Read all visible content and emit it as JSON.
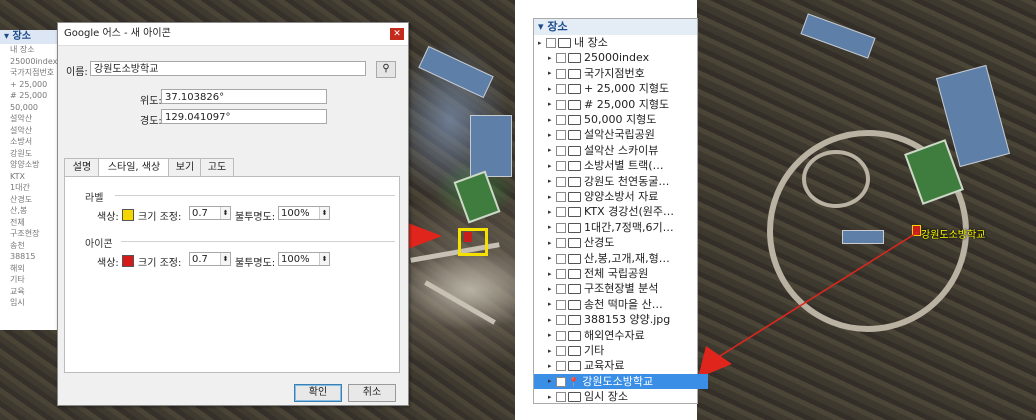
{
  "left_panel": {
    "header": "▾ 장소",
    "rows": [
      "내 장소",
      "25000index",
      "국가지점번호",
      "+ 25,000",
      "# 25,000",
      "50,000",
      "설악산",
      "설악산",
      "소방서",
      "강원도",
      "양양소방",
      "KTX",
      "1대간",
      "산경도",
      "산,봉",
      "전체",
      "구조현장",
      "송천",
      "38815",
      "해외",
      "기타",
      "교육",
      "임시"
    ]
  },
  "dialog": {
    "title": "Google 어스 - 새 아이콘",
    "name_label": "이름:",
    "name_value": "강원도소방학교",
    "lat_label": "위도:",
    "lat_value": "37.103826°",
    "lng_label": "경도:",
    "lng_value": "129.041097°",
    "tabs": [
      "설명",
      "스타일, 색상",
      "보기",
      "고도"
    ],
    "label_group": "라벨",
    "icon_group": "아이콘",
    "color_label": "색상:",
    "scale_label": "크기 조정:",
    "scale_value": "0.7",
    "opacity_label": "불투명도:",
    "opacity_value": "100%",
    "label_color": "#f5d600",
    "icon_color": "#d61a1a",
    "ok": "확인",
    "cancel": "취소"
  },
  "map_label": "강원도소방학교",
  "right_panel": {
    "header": "▾ 장소",
    "items": [
      {
        "label": "내 장소",
        "root": true
      },
      {
        "label": "25000index"
      },
      {
        "label": "국가지점번호"
      },
      {
        "label": "+ 25,000 지형도"
      },
      {
        "label": "# 25,000 지형도"
      },
      {
        "label": "50,000 지형도"
      },
      {
        "label": "설악산국립공원"
      },
      {
        "label": "설악산 스카이뷰"
      },
      {
        "label": "소방서별 트랙(…"
      },
      {
        "label": "강원도 천연동굴…"
      },
      {
        "label": "양양소방서 자료"
      },
      {
        "label": "KTX 경강선(원주…"
      },
      {
        "label": "1대간,7정맥,6기…"
      },
      {
        "label": "산경도"
      },
      {
        "label": "산,봉,고개,재,형…"
      },
      {
        "label": "전체 국립공원"
      },
      {
        "label": "구조현장별 분석"
      },
      {
        "label": "송천 떡마을 산…"
      },
      {
        "label": "388153 양양.jpg"
      },
      {
        "label": "해외연수자료"
      },
      {
        "label": "기타"
      },
      {
        "label": "교육자료"
      },
      {
        "label": "강원도소방학교",
        "selected": true
      },
      {
        "label": "임시 장소"
      }
    ]
  }
}
